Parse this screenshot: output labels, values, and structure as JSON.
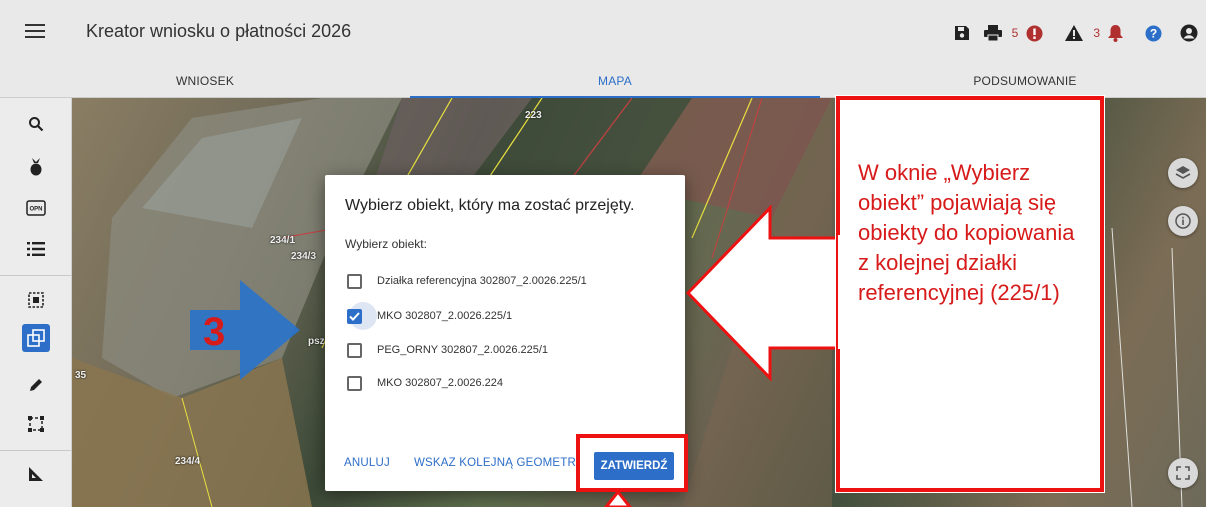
{
  "header": {
    "title": "Kreator wniosku o płatności 2026",
    "errors_count": "5",
    "warnings_count": "3"
  },
  "tabs": [
    {
      "label": "WNIOSEK"
    },
    {
      "label": "MAPA"
    },
    {
      "label": "PODSUMOWANIE"
    }
  ],
  "map_labels": [
    "223",
    "234/1",
    "234/3",
    "234/4",
    "35",
    "psz"
  ],
  "dialog": {
    "title": "Wybierz obiekt, który ma zostać przejęty.",
    "subtitle": "Wybierz obiekt:",
    "options": [
      {
        "label": "Działka referencyjna 302807_2.0026.225/1",
        "checked": false
      },
      {
        "label": "MKO 302807_2.0026.225/1",
        "checked": true
      },
      {
        "label": "PEG_ORNY 302807_2.0026.225/1",
        "checked": false
      },
      {
        "label": "MKO 302807_2.0026.224",
        "checked": false
      }
    ],
    "cancel_label": "ANULUJ",
    "next_geometry_label": "WSKAŻ KOLEJNĄ GEOMETRIĘ",
    "confirm_label": "ZATWIERDŹ"
  },
  "annotation": {
    "callout_text": "W oknie „Wybierz obiekt” pojawiają się obiekty do kopiowania z kolejnej działki referencyjnej (225/1)",
    "step_number": "3"
  },
  "colors": {
    "accent": "#2d6ec8",
    "annotation": "#d71a1a",
    "error": "#b03030"
  }
}
